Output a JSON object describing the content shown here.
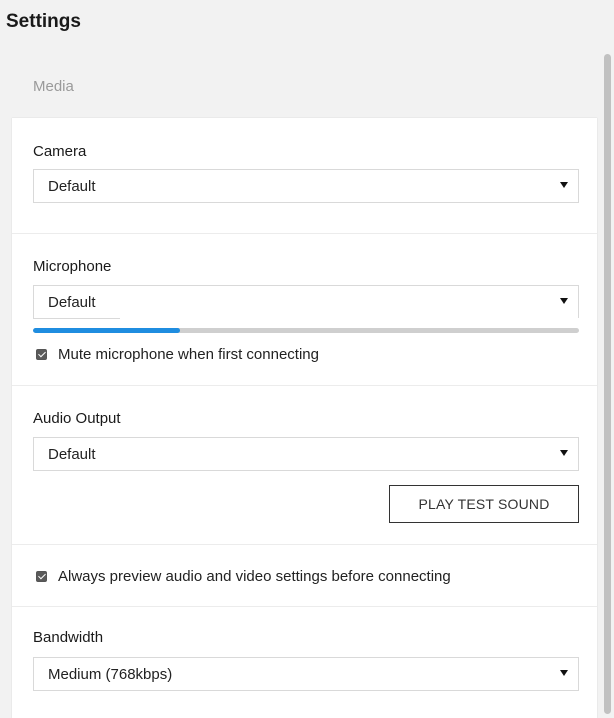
{
  "header": {
    "title": "Settings"
  },
  "section": {
    "label": "Media"
  },
  "camera": {
    "label": "Camera",
    "value": "Default"
  },
  "microphone": {
    "label": "Microphone",
    "value": "Default",
    "level_fraction": 0.27,
    "mute_label": "Mute microphone when first connecting",
    "mute_checked": true
  },
  "audio_output": {
    "label": "Audio Output",
    "value": "Default",
    "test_button": "PLAY TEST SOUND"
  },
  "preview": {
    "label": "Always preview audio and video settings before connecting",
    "checked": true
  },
  "bandwidth": {
    "label": "Bandwidth",
    "value": "Medium (768kbps)"
  },
  "colors": {
    "accent": "#1f8de0",
    "meter_track": "#cfcfcf",
    "background": "#f2f2f2"
  },
  "icons": {
    "select_arrow": "caret-down-icon",
    "checkbox": "checkbox-checked-icon"
  }
}
